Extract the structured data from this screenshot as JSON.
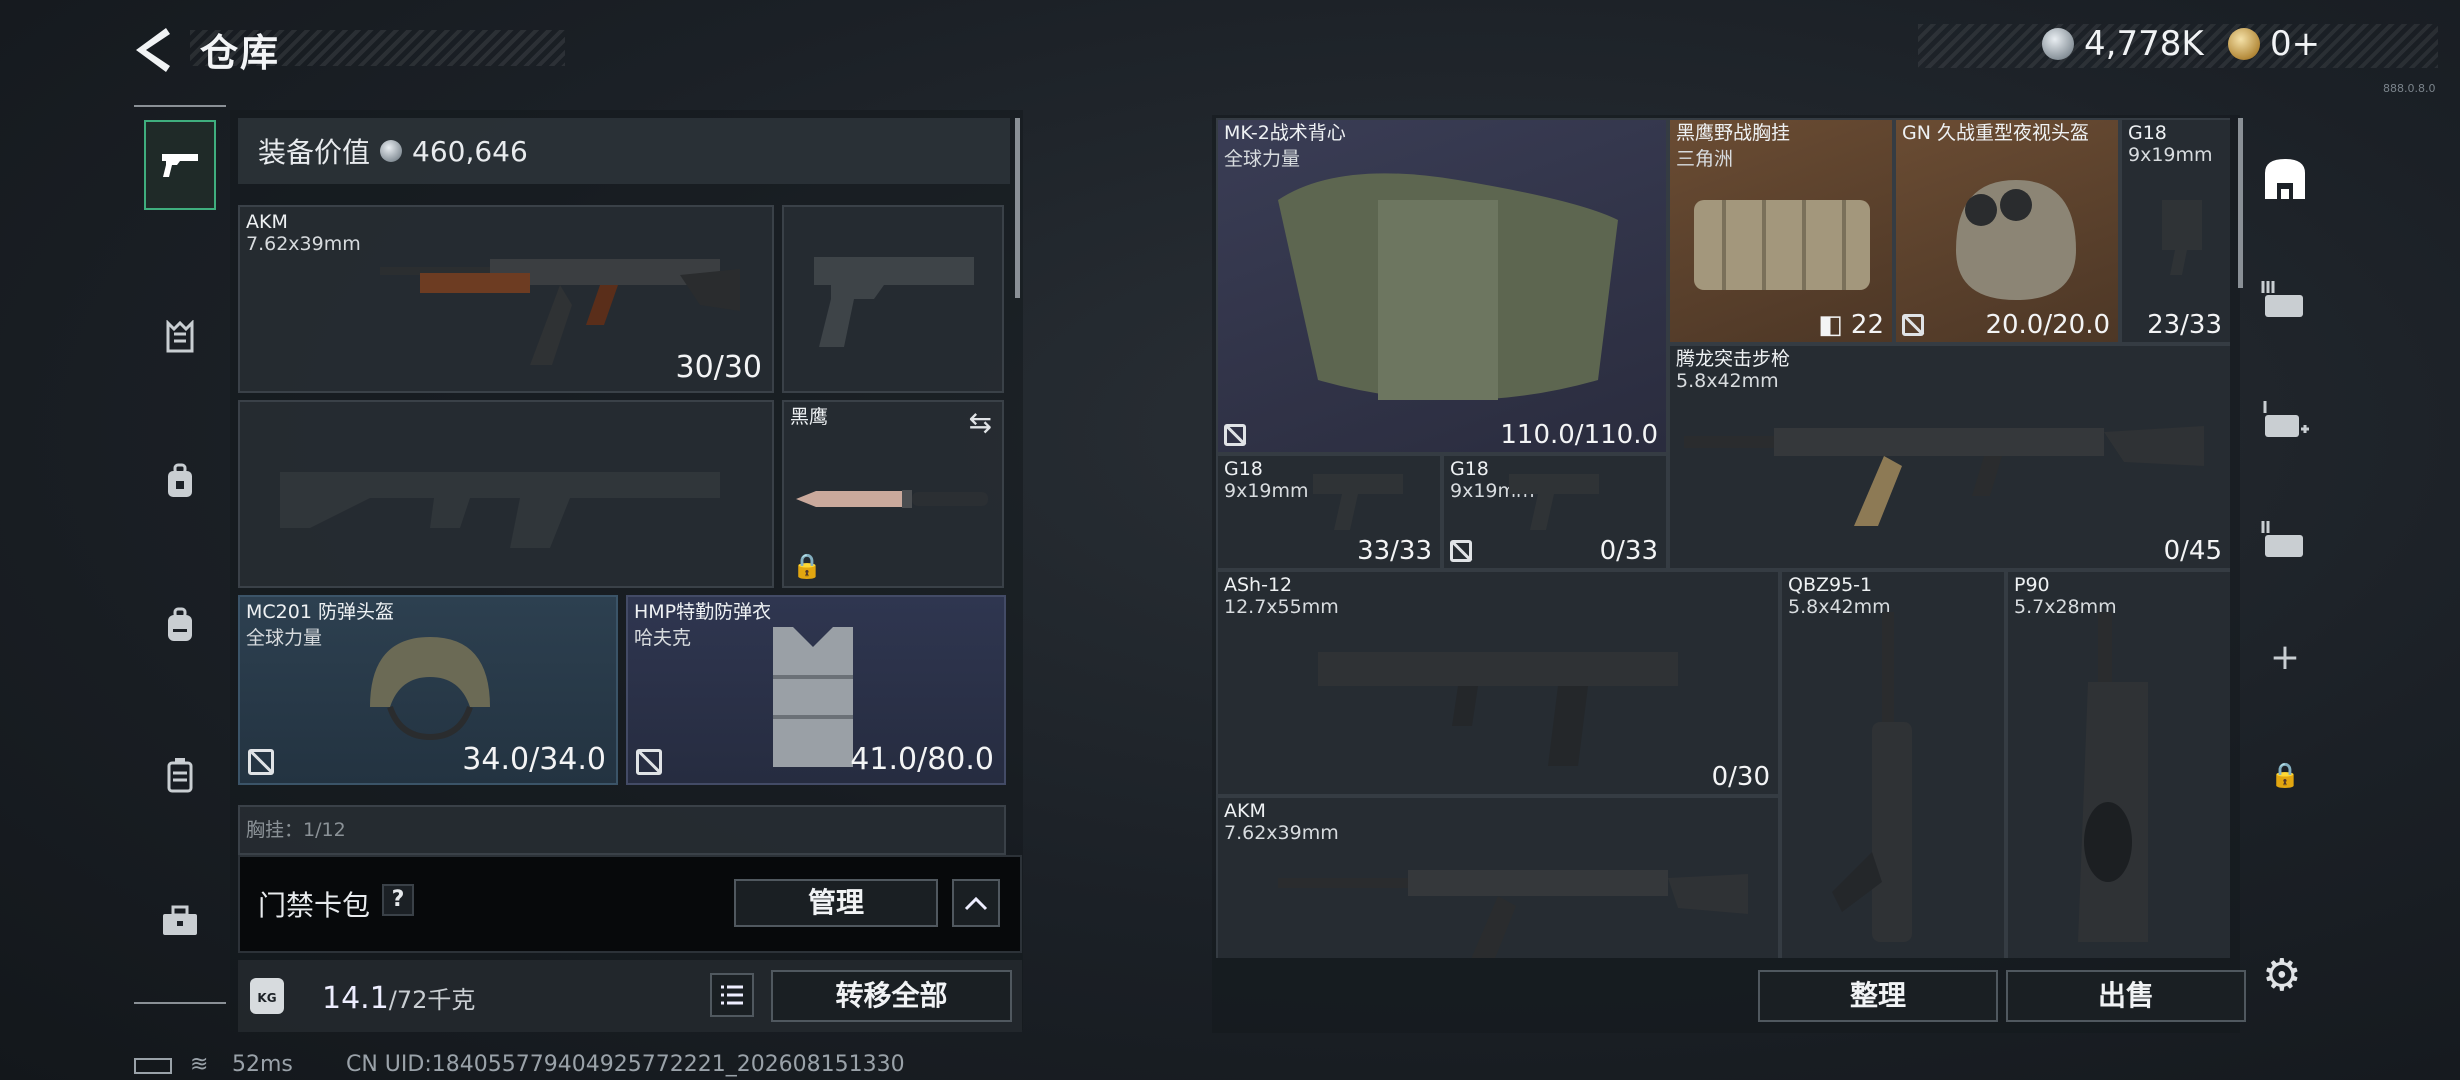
{
  "header": {
    "title": "仓库",
    "back_icon": "back-arrow-icon"
  },
  "currency": {
    "silver": "4,778K",
    "gold": "0+"
  },
  "version": "888.0.8.0",
  "left_tabs": [
    {
      "icon": "pistol-icon",
      "active": true
    },
    {
      "icon": "vest-icon"
    },
    {
      "icon": "backpack-lock-icon"
    },
    {
      "icon": "backpack-icon"
    },
    {
      "icon": "case-icon"
    },
    {
      "icon": "toolbox-icon"
    }
  ],
  "equipment": {
    "value_label": "装备价值",
    "value": "460,646",
    "primary": {
      "name": "AKM",
      "caliber": "7.62x39mm",
      "count": "30/30"
    },
    "knife": {
      "name": "黑鹰"
    },
    "helmet": {
      "name": "MC201 防弹头盔",
      "brand": "全球力量",
      "durability": "34.0/34.0"
    },
    "armor": {
      "name": "HMP特勤防弹衣",
      "brand": "哈夫克",
      "durability": "41.0/80.0"
    },
    "chest_partial": "胸挂：1/12"
  },
  "card_bar": {
    "label": "门禁卡包",
    "help": "?",
    "manage": "管理"
  },
  "weight": {
    "current": "14.1",
    "max": "/72千克",
    "kg_label": "KG"
  },
  "transfer_all": "转移全部",
  "status": {
    "ping": "52ms",
    "uid": "CN UID:18405577940492577222​1_202608151330"
  },
  "storage": {
    "items": [
      {
        "name": "MK-2战术背心",
        "sub": "全球力量",
        "count": "110.0/110.0"
      },
      {
        "name": "黑鹰野战胸挂",
        "sub": "三角洲",
        "count": "22"
      },
      {
        "name": "GN 久战重型夜视头盔",
        "sub": "",
        "count": "20.0/20.0"
      },
      {
        "name": "G18",
        "sub": "9x19mm",
        "count": "23/33"
      },
      {
        "name": "腾龙突击步枪",
        "sub": "5.8x42mm",
        "count": "0/45"
      },
      {
        "name": "G18",
        "sub": "9x19mm",
        "count": "33/33"
      },
      {
        "name": "G18",
        "sub": "9x19mm",
        "count": "0/33"
      },
      {
        "name": "ASh-12",
        "sub": "12.7x55mm",
        "count": "0/30"
      },
      {
        "name": "QBZ95-1",
        "sub": "5.8x42mm",
        "count": ""
      },
      {
        "name": "P90",
        "sub": "5.7x28mm",
        "count": ""
      },
      {
        "name": "AKM",
        "sub": "7.62x39mm",
        "count": ""
      }
    ],
    "sort": "整理",
    "sell": "出售"
  },
  "right_tabs": [
    {
      "icon": "storage-icon",
      "active": true
    },
    {
      "icon": "storage-page-3-icon"
    },
    {
      "icon": "storage-page-add-icon"
    },
    {
      "icon": "storage-page-2-icon"
    },
    {
      "icon": "plus-icon"
    },
    {
      "icon": "lock-icon"
    }
  ],
  "colors": {
    "accent": "#3fae7e",
    "panel": "#262c32",
    "purple_tier": "#3a3d55",
    "orange_tier": "#6a4c33",
    "blue_tier": "#2d4050"
  }
}
